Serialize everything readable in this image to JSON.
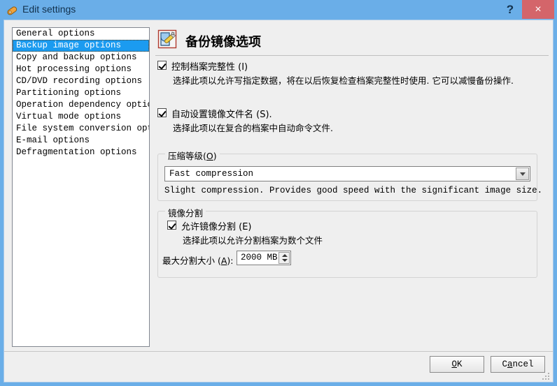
{
  "window": {
    "title": "Edit settings",
    "icon": "tag-icon",
    "help_label": "?",
    "close_label": "×",
    "titlebar_color": "#6aaee8",
    "close_color": "#d4656a"
  },
  "sidebar": {
    "items": [
      {
        "label": "General options",
        "selected": false
      },
      {
        "label": "Backup image options",
        "selected": true
      },
      {
        "label": "Copy and backup options",
        "selected": false
      },
      {
        "label": "Hot processing options",
        "selected": false
      },
      {
        "label": "CD/DVD recording options",
        "selected": false
      },
      {
        "label": "Partitioning options",
        "selected": false
      },
      {
        "label": "Operation dependency options",
        "selected": false
      },
      {
        "label": "Virtual mode options",
        "selected": false
      },
      {
        "label": "File system conversion options",
        "selected": false
      },
      {
        "label": "E-mail options",
        "selected": false
      },
      {
        "label": "Defragmentation options",
        "selected": false
      }
    ],
    "selection_color": "#1b9bf0"
  },
  "page": {
    "icon": "document-pencil-icon",
    "title": "备份镜像选项"
  },
  "options": {
    "integrity": {
      "label": "控制档案完整性 (I)",
      "description": "选择此项以允许写指定数据，将在以后恢复检查档案完整性时使用. 它可以减慢备份操作.",
      "checked": true
    },
    "autoname": {
      "label": "自动设置镜像文件名 (S).",
      "description": "选择此项以在复合的档案中自动命令文件.",
      "checked": true
    }
  },
  "compression_group": {
    "title_prefix": "压缩等级(",
    "title_mnemonic": "O",
    "title_suffix": ")",
    "selected_value": "Fast compression",
    "description": "Slight compression. Provides good speed with the significant image size.",
    "dropdown_icon": "chevron-down-icon"
  },
  "split_group": {
    "title": "镜像分割",
    "enable": {
      "label": "允许镜像分割 (E)",
      "description": "选择此项以允许分割档案为数个文件",
      "checked": true
    },
    "max_size_label_prefix": "最大分割大小 (",
    "max_size_label_mnemonic": "A",
    "max_size_label_suffix": "):",
    "max_size_value": "2000 MB",
    "stepper_up_icon": "triangle-up-icon",
    "stepper_down_icon": "triangle-down-icon"
  },
  "footer": {
    "ok_prefix": "",
    "ok_mnemonic": "O",
    "ok_suffix": "K",
    "cancel_prefix": "C",
    "cancel_mnemonic": "a",
    "cancel_suffix": "ncel",
    "grip_icon": "resize-grip-icon"
  }
}
